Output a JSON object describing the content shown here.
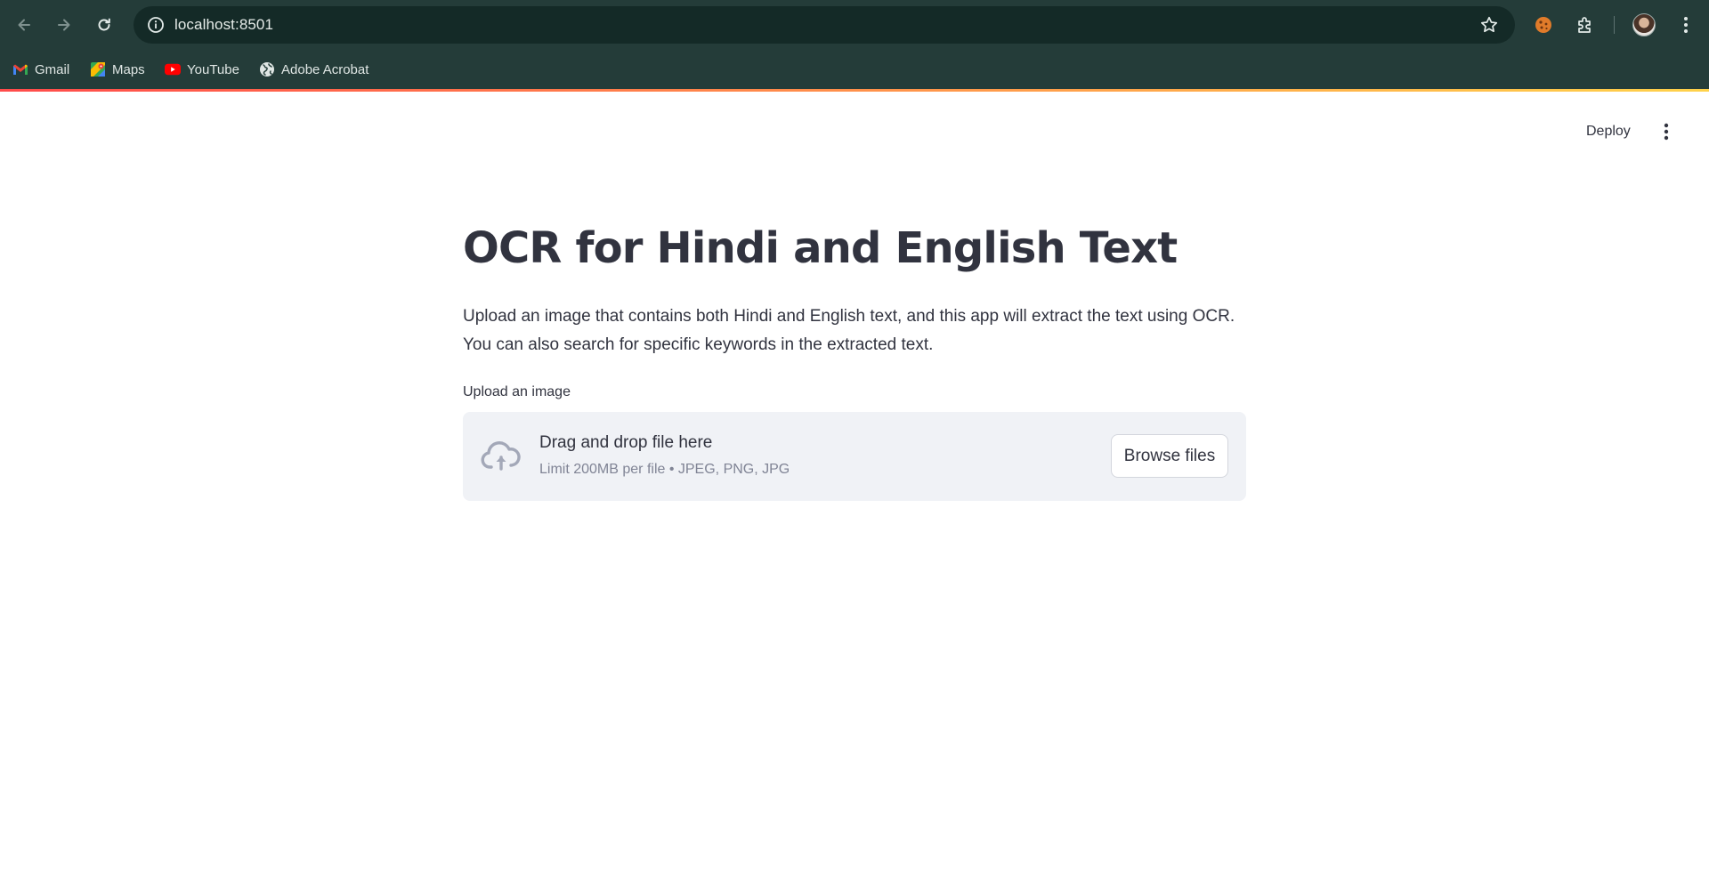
{
  "browser": {
    "url": "localhost:8501",
    "bookmarks": [
      {
        "label": "Gmail",
        "icon": "gmail-icon"
      },
      {
        "label": "Maps",
        "icon": "maps-icon"
      },
      {
        "label": "YouTube",
        "icon": "youtube-icon"
      },
      {
        "label": "Adobe Acrobat",
        "icon": "globe-icon"
      }
    ],
    "icons": [
      "back-arrow-icon",
      "forward-arrow-icon",
      "reload-icon",
      "site-info-icon",
      "bookmark-star-icon",
      "cookie-extension-icon",
      "extensions-puzzle-icon",
      "profile-avatar",
      "browser-menu-icon"
    ],
    "colors": {
      "chrome_bg": "#243c39",
      "omnibox_bg": "#142a27",
      "accent_gradient_start": "#ff4b4b",
      "accent_gradient_end": "#ffd24b"
    }
  },
  "app": {
    "header": {
      "deploy_label": "Deploy",
      "menu_icon": "vertical-dots-icon"
    },
    "title": "OCR for Hindi and English Text",
    "description": "Upload an image that contains both Hindi and English text, and this app will extract the text using OCR. You can also search for specific keywords in the extracted text.",
    "uploader": {
      "label": "Upload an image",
      "drop_text": "Drag and drop file here",
      "limit_text": "Limit 200MB per file • JPEG, PNG, JPG",
      "browse_label": "Browse files",
      "icon": "cloud-upload-icon"
    },
    "colors": {
      "text": "#31333f",
      "muted_text": "#808495",
      "dropzone_bg": "#f0f2f6"
    }
  }
}
